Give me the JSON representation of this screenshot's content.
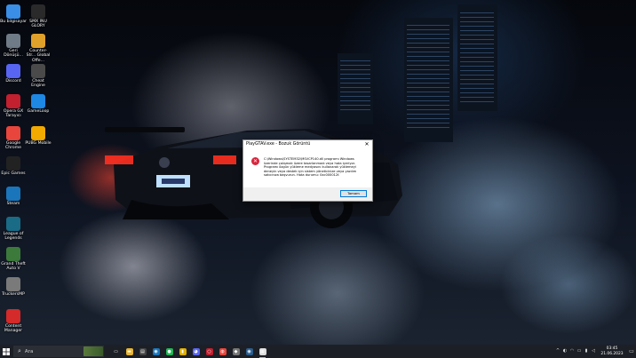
{
  "desktop": {
    "icons": [
      {
        "label": "Bu bilgisayar",
        "icon": "computer-icon",
        "color": "#3a8ee6"
      },
      {
        "label": "SMX INU GLORY",
        "icon": "mouse-icon",
        "color": "#2a2a2a"
      },
      {
        "label": "Geri Dönüşü...",
        "icon": "recycle-bin-icon",
        "color": "#6f7b86"
      },
      {
        "label": "Counter-Str... Global Offe...",
        "icon": "csgo-icon",
        "color": "#e0a12a"
      },
      {
        "label": "Discord",
        "icon": "discord-icon",
        "color": "#5865f2"
      },
      {
        "label": "Cheat Engine",
        "icon": "cheat-engine-icon",
        "color": "#4a4a4a"
      },
      {
        "label": "Opera GX Tarayıcı",
        "icon": "opera-gx-icon",
        "color": "#c21f2f"
      },
      {
        "label": "GameLoop",
        "icon": "gameloop-icon",
        "color": "#1e88e5"
      },
      {
        "label": "Google Chrome",
        "icon": "chrome-icon",
        "color": "#e8453c"
      },
      {
        "label": "PUBG Mobile",
        "icon": "pubg-mobile-icon",
        "color": "#f2a900"
      },
      {
        "label": "Epic Games",
        "icon": "epic-games-icon",
        "color": "#222222"
      },
      {
        "label": "Steam",
        "icon": "steam-icon",
        "color": "#1b75bb"
      },
      {
        "label": "League of Legends",
        "icon": "league-icon",
        "color": "#1a6b86"
      },
      {
        "label": "Grand Theft Auto V",
        "icon": "gta-icon",
        "color": "#3c7a3c"
      },
      {
        "label": "TruckersMP",
        "icon": "truckersmp-icon",
        "color": "#7a7a7a"
      },
      {
        "label": "Content Manager",
        "icon": "content-manager-icon",
        "color": "#d42a2a"
      }
    ]
  },
  "dialog": {
    "title": "PlayGTAV.exe - Bozuk Görüntü",
    "message": "C:\\Windows\\SYSTEM32\\MSVCP140.dll programı Windows üzerinde çalışmak üzere tasarlanmadı veya hata içeriyor. Programı özgün yükleme medyasını kullanarak yüklemeyi deneyin veya destek için sistem yöneticinize veya yazılım satıcınıza başvurun. Hata durumu: 0xc000012f.",
    "ok_label": "Tamam",
    "close_glyph": "✕",
    "error_glyph": "✕"
  },
  "taskbar": {
    "search_placeholder": "Ara",
    "apps": [
      {
        "icon": "task-view-icon",
        "glyph": "▭",
        "color": "#1c1f25"
      },
      {
        "icon": "file-explorer-icon",
        "glyph": "▬",
        "color": "#e8b530"
      },
      {
        "icon": "terminal-icon",
        "glyph": "▤",
        "color": "#444"
      },
      {
        "icon": "steam-icon",
        "glyph": "◉",
        "color": "#1b75bb"
      },
      {
        "icon": "spotify-icon",
        "glyph": "●",
        "color": "#1db954"
      },
      {
        "icon": "notes-icon",
        "glyph": "▮",
        "color": "#e0b000"
      },
      {
        "icon": "discord-icon",
        "glyph": "◕",
        "color": "#5865f2"
      },
      {
        "icon": "opera-gx-icon",
        "glyph": "○",
        "color": "#c21f2f"
      },
      {
        "icon": "chrome-icon",
        "glyph": "◍",
        "color": "#e8453c"
      },
      {
        "icon": "shield-icon",
        "glyph": "◆",
        "color": "#777"
      },
      {
        "icon": "steam-2-icon",
        "glyph": "◉",
        "color": "#2a5d8f"
      },
      {
        "icon": "error-window-icon",
        "glyph": "▦",
        "color": "#dcdcdc"
      }
    ],
    "tray": [
      "network-icon",
      "wifi-icon",
      "keyboard-icon",
      "battery-icon",
      "volume-icon"
    ],
    "time": "03:45",
    "date": "21.06.2023"
  }
}
